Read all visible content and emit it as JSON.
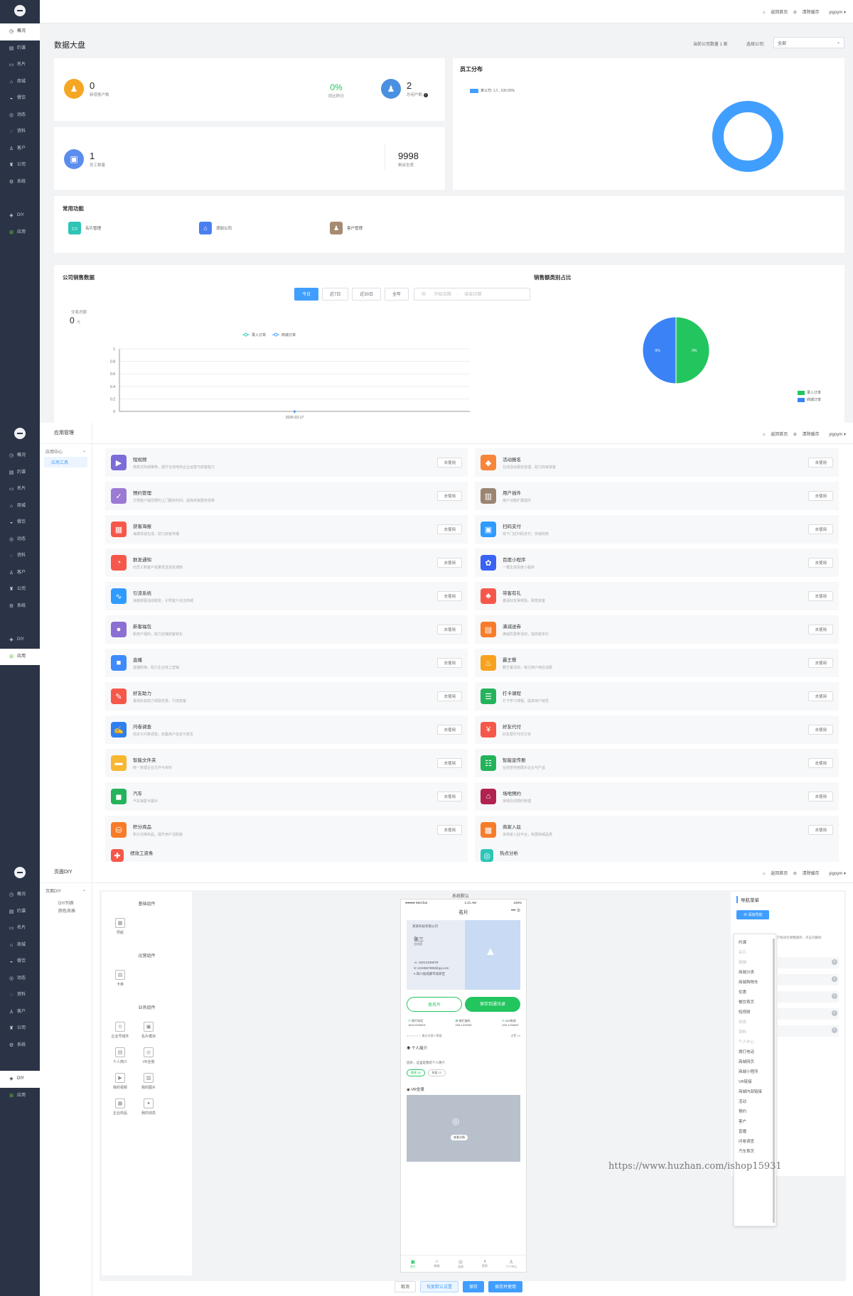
{
  "sidebar": {
    "items": [
      "概况",
      "约课",
      "名片",
      "商城",
      "餐饮",
      "动态",
      "资料",
      "客户",
      "公司",
      "系统"
    ],
    "diy": "DIY",
    "app": "应用"
  },
  "topbar": {
    "home": "返回首页",
    "clear": "清除缓存",
    "user": "yigoym"
  },
  "dashboard": {
    "title": "数据大盘",
    "company_count": "当前公司数量 1 家",
    "select_label": "选择公司:",
    "select_value": "全部",
    "new_customers_num": "0",
    "new_customers_label": "新增客户数",
    "compare_pct": "0%",
    "compare_label": "同比昨日",
    "total_users_num": "2",
    "total_users_label": "总用户数",
    "staff_num": "1",
    "staff_label": "员工数量",
    "seats_num": "9998",
    "seats_label": "剩余坐席",
    "staff_dist_title": "员工分布",
    "staff_dist_legend": "某公司: 1人, 100.00%",
    "common_title": "常用功能",
    "common_items": [
      "名片管理",
      "添加公司",
      "客户管理"
    ],
    "sales_title": "公司销售数据",
    "tabs": [
      "今日",
      "近7日",
      "近30日",
      "全年"
    ],
    "start_date": "开始日期",
    "end_date": "结束日期",
    "trade_label": "交易总额",
    "trade_value": "0",
    "trade_unit": "元",
    "pie_title": "销售额类别占比",
    "pie_left_label": "0%",
    "pie_right_label": "0%"
  },
  "chart_data": [
    {
      "type": "line",
      "x": [
        "2026-03-17"
      ],
      "ylim": [
        0,
        1
      ],
      "yticks": [
        "0",
        "0.2",
        "0.4",
        "0.6",
        "0.8",
        "1"
      ],
      "series": [
        {
          "name": "录入订单",
          "values": [
            0
          ]
        },
        {
          "name": "商城订单",
          "values": [
            0
          ]
        }
      ]
    },
    {
      "type": "pie",
      "categories": [
        "录入订单",
        "商城订单"
      ],
      "values": [
        50,
        50
      ],
      "colors": [
        "#22c55e",
        "#3b82f6"
      ]
    }
  ],
  "apps": {
    "section_title": "应用管理",
    "center": "应用中心",
    "tool": "应用工具",
    "use_label": "去使用",
    "left": [
      {
        "name": "短视频",
        "desc": "随意式商城推荐，提升在线电商企业运营与获客能力",
        "color": "#7b6cd8",
        "icon": "▶"
      },
      {
        "name": "预约管理",
        "desc": "方便客户提前预约上门服务时间，提高商家服务效率",
        "color": "#9b7ad4",
        "icon": "✓"
      },
      {
        "name": "获客海报",
        "desc": "海报快速生成，助力获客传播",
        "color": "#f5584a",
        "icon": "▦"
      },
      {
        "name": "群发通知",
        "desc": "向员工和客户批量发送消息通知",
        "color": "#f5584a",
        "icon": "◔"
      },
      {
        "name": "引流系统",
        "desc": "海报拼图活动裂变，引导客户关注商城",
        "color": "#2f9bff",
        "icon": "∿"
      },
      {
        "name": "新客福包",
        "desc": "新用户福利，助力店铺获客转化",
        "color": "#8b6fd2",
        "icon": "●"
      },
      {
        "name": "直播",
        "desc": "直播购物，助力企业线上营销",
        "color": "#3d8bfd",
        "icon": "■"
      },
      {
        "name": "好友助力",
        "desc": "邀请好友助力领取优惠，引流拓客",
        "color": "#f5584a",
        "icon": "✎"
      },
      {
        "name": "问卷调查",
        "desc": "自定义问卷调查，收集用户信息与意见",
        "color": "#2f7ff0",
        "icon": "✍"
      },
      {
        "name": "智能文件夹",
        "desc": "统一管理企业文件与资料",
        "color": "#f7b731",
        "icon": "▬"
      },
      {
        "name": "汽车",
        "desc": "汽车销售与展示",
        "color": "#24b35a",
        "icon": "◼"
      },
      {
        "name": "积分商品",
        "desc": "积分兑换商品，提升用户活跃度",
        "color": "#f77c2a",
        "icon": "⛁"
      }
    ],
    "right": [
      {
        "name": "活动报名",
        "desc": "在线活动报名管理，助力商家获客",
        "color": "#f7853a",
        "icon": "◆"
      },
      {
        "name": "用户插件",
        "desc": "用户功能扩展插件",
        "color": "#9b8572",
        "icon": "▥"
      },
      {
        "name": "扫码支付",
        "desc": "线下门店扫码支付，快速收款",
        "color": "#2f9bff",
        "icon": "▣"
      },
      {
        "name": "百度小程序",
        "desc": "一键生成百度小程序",
        "color": "#3a62f5",
        "icon": "✿"
      },
      {
        "name": "带客有礼",
        "desc": "邀请好友得奖励，裂变获客",
        "color": "#f5584a",
        "icon": "♣"
      },
      {
        "name": "满减送券",
        "desc": "满减优惠券活动，提高客单价",
        "color": "#f77c2a",
        "icon": "▤"
      },
      {
        "name": "霸王餐",
        "desc": "霸王餐活动，吸引用户到店消费",
        "color": "#f7a21e",
        "icon": "♨"
      },
      {
        "name": "打卡课程",
        "desc": "打卡学习课程，提高用户粘性",
        "color": "#24b35a",
        "icon": "☰"
      },
      {
        "name": "好友代付",
        "desc": "好友帮忙代付订单",
        "color": "#f5584a",
        "icon": "¥"
      },
      {
        "name": "智能宣传册",
        "desc": "在线宣传册展示企业与产品",
        "color": "#24b35a",
        "icon": "☷"
      },
      {
        "name": "场地预约",
        "desc": "场地在线预约管理",
        "color": "#b0224f",
        "icon": "⌂"
      },
      {
        "name": "商家入驻",
        "desc": "多商家入驻平台，拓展商城品类",
        "color": "#f77c2a",
        "icon": "▩"
      }
    ],
    "partial_left": "绩效工资条",
    "partial_right": "热点分析"
  },
  "diy": {
    "title": "页面DIY",
    "menu": "页面DIY",
    "sub1": "DIY列表",
    "sub2": "颜色风格",
    "groups": [
      {
        "name": "基础组件",
        "items": [
          "导航"
        ]
      },
      {
        "name": "运营组件",
        "items": [
          "卡券"
        ]
      },
      {
        "name": "业务组件",
        "items": [
          "企业号组件",
          "名片模块",
          "个人简介",
          "VR全景",
          "我的视频",
          "我的图片",
          "企业商品",
          "我的动态"
        ]
      }
    ],
    "preview_title": "系统默认",
    "phone_status": "●●●●● WeChat",
    "phone_time": "1:21 AM",
    "phone_battery": "100%",
    "card_title": "名片",
    "company": "某某科技有限公司",
    "person": "张三",
    "position": "总经理",
    "phone": "18212345678",
    "email": "1234567890@qq.com",
    "address": "四川省成都市高新区",
    "send_btn": "发名片",
    "save_btn": "保存到通讯录",
    "call_label": "拨打电话",
    "call_num": "18212345678",
    "tel_label": "拨打座机",
    "tel_num": "028-1234567",
    "hotline_label": "400热线",
    "hotline_num": "400-1234567",
    "viewers": "最近访客人数据",
    "likes": "点赞 10",
    "intro_title": "个人简介",
    "intro_text": "您好，这里是我的个人简介",
    "like_btn": "靠谱 38",
    "fav_btn": "热度 12",
    "vr_title": "VR全景",
    "vr_btn": "查看详情",
    "tabs": [
      "名片",
      "商城",
      "动态",
      "官网",
      "个人中心"
    ],
    "nav_title": "导航菜单",
    "add_nav": "添加导航",
    "nav_hint": "上下拖动可调整顺序，点击可删除",
    "nav_list": [
      "约课",
      "名片",
      "商城",
      "商城分类",
      "商城购物车",
      "优惠",
      "餐饮首页",
      "短视频",
      "动态",
      "资料",
      "个人中心",
      "拨打电话",
      "商城网页",
      "商城小程序",
      "VR链接",
      "商城内部链接",
      "活动",
      "预约",
      "客户",
      "直播",
      "问卷调查",
      "汽车首页"
    ],
    "nav_dim": [
      1,
      2,
      8,
      9,
      10
    ],
    "footer": [
      "取消",
      "恢复默认设置",
      "保存",
      "保存并使用"
    ],
    "watermark": "https://www.huzhan.com/ishop15931"
  },
  "colors": {
    "primary": "#409eff",
    "sidebar": "#2b3346",
    "orange": "#f5a623",
    "green": "#22c55e"
  }
}
